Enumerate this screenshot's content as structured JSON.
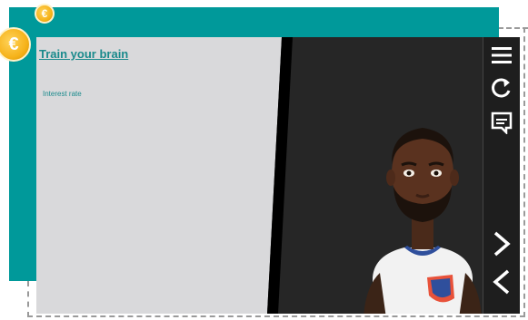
{
  "header": {
    "title": "Train your brain",
    "subtitle": "Interest rate"
  },
  "coins": {
    "symbol": "€"
  },
  "toolbar": {
    "icons": [
      "menu-icon",
      "refresh-icon",
      "transcript-icon",
      "next-icon",
      "previous-icon"
    ]
  },
  "colors": {
    "teal": "#00999a",
    "panel": "#d9d9db",
    "stage": "#262626",
    "accent_text": "#1a8a8c",
    "coin": "#f6b31b"
  }
}
